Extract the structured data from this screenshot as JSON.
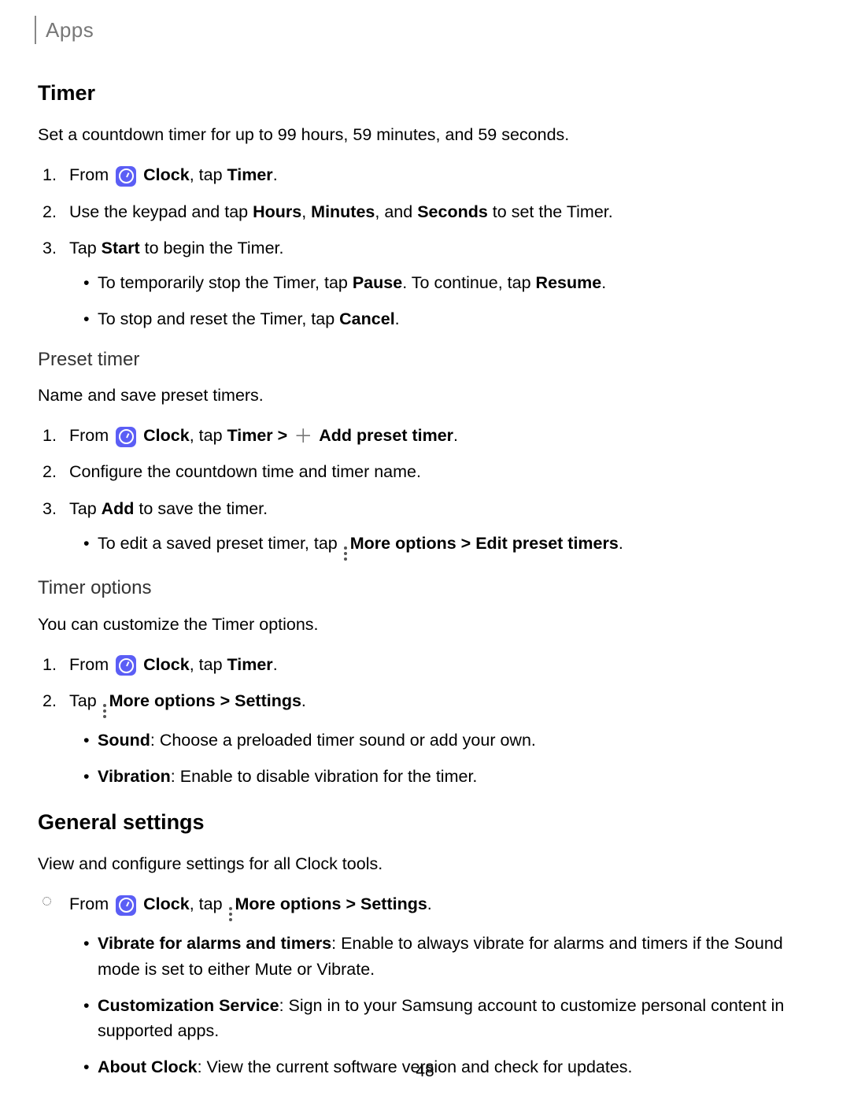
{
  "breadcrumb": "Apps",
  "page_number": "48",
  "timer": {
    "title": "Timer",
    "intro": "Set a countdown timer for up to 99 hours, 59 minutes, and 59 seconds.",
    "step1_prefix": "From",
    "step1_clock": "Clock",
    "step1_suffix": ", tap ",
    "step1_timer": "Timer",
    "step1_period": ".",
    "step2_a": "Use the keypad and tap ",
    "step2_hours": "Hours",
    "step2_b": ", ",
    "step2_minutes": "Minutes",
    "step2_c": ", and ",
    "step2_seconds": "Seconds",
    "step2_d": " to set the Timer.",
    "step3_a": "Tap ",
    "step3_start": "Start",
    "step3_b": " to begin the Timer.",
    "sub1_a": "To temporarily stop the Timer, tap ",
    "sub1_pause": "Pause",
    "sub1_b": ". To continue, tap ",
    "sub1_resume": "Resume",
    "sub1_c": ".",
    "sub2_a": "To stop and reset the Timer, tap ",
    "sub2_cancel": "Cancel",
    "sub2_b": "."
  },
  "preset": {
    "title": "Preset timer",
    "intro": "Name and save preset timers.",
    "step1_prefix": "From",
    "step1_clock": "Clock",
    "step1_a": ", tap ",
    "step1_timer": "Timer",
    "step1_arrow": " > ",
    "step1_add": "Add preset timer",
    "step1_period": ".",
    "step2": "Configure the countdown time and timer name.",
    "step3_a": "Tap ",
    "step3_add": "Add",
    "step3_b": " to save the timer.",
    "sub1_a": "To edit a saved preset timer, tap ",
    "sub1_more": "More options > Edit preset timers",
    "sub1_b": "."
  },
  "options": {
    "title": "Timer options",
    "intro": "You can customize the Timer options.",
    "step1_prefix": "From",
    "step1_clock": "Clock",
    "step1_a": ", tap ",
    "step1_timer": "Timer",
    "step1_period": ".",
    "step2_a": "Tap ",
    "step2_more": "More options > Settings",
    "step2_b": ".",
    "sub1_label": "Sound",
    "sub1_text": ": Choose a preloaded timer sound or add your own.",
    "sub2_label": "Vibration",
    "sub2_text": ": Enable to disable vibration for the timer."
  },
  "general": {
    "title": "General settings",
    "intro": "View and configure settings for all Clock tools.",
    "step1_prefix": "From",
    "step1_clock": "Clock",
    "step1_a": ", tap ",
    "step1_more": "More options > Settings",
    "step1_b": ".",
    "sub1_label": "Vibrate for alarms and timers",
    "sub1_text": ": Enable to always vibrate for alarms and timers if the Sound mode is set to either Mute or Vibrate.",
    "sub2_label": "Customization Service",
    "sub2_text": ": Sign in to your Samsung account to customize personal content in supported apps.",
    "sub3_label": "About Clock",
    "sub3_text": ": View the current software version and check for updates."
  }
}
